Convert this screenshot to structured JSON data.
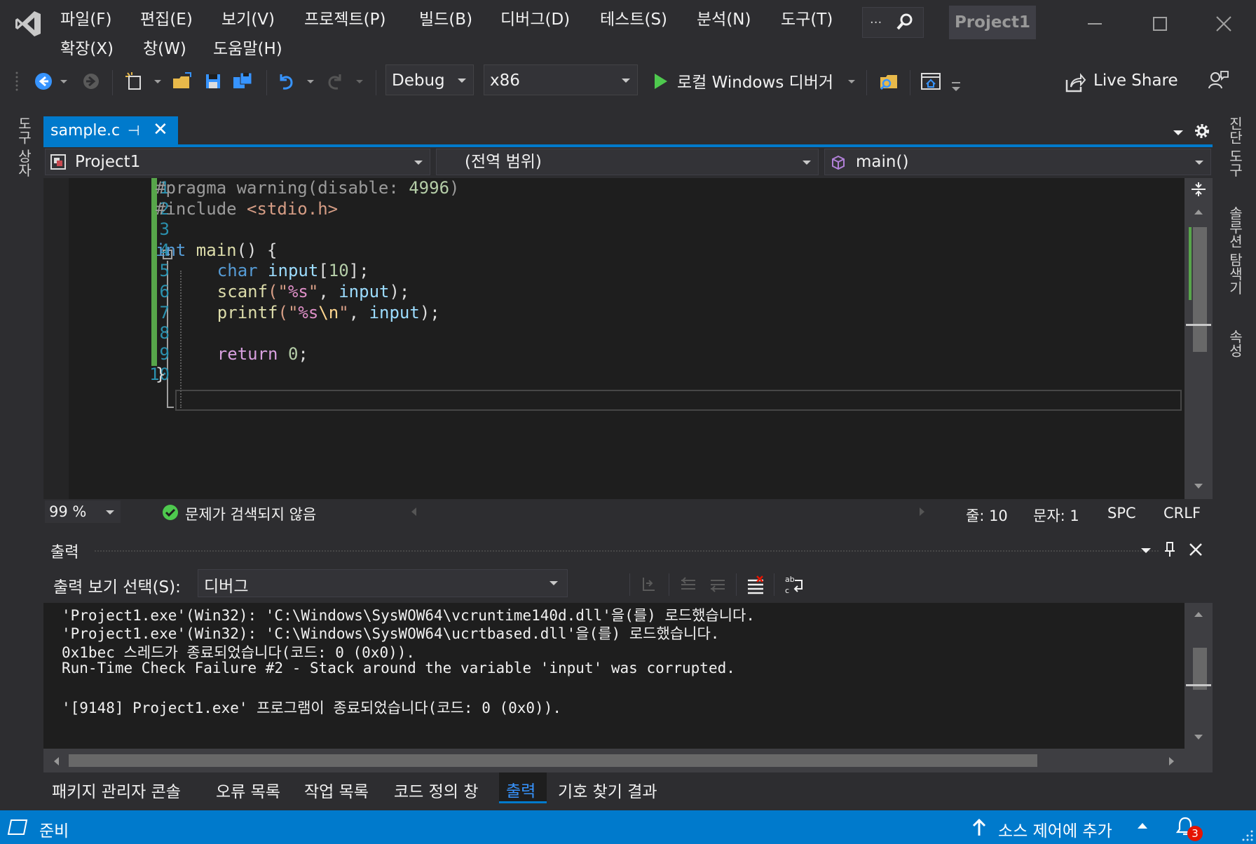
{
  "menu": {
    "items": [
      "파일(F)",
      "편집(E)",
      "보기(V)",
      "프로젝트(P)",
      "빌드(B)",
      "디버그(D)",
      "테스트(S)",
      "분석(N)",
      "도구(T)",
      "확장(X)",
      "창(W)",
      "도움말(H)"
    ],
    "search_dots": "...",
    "project_title": "Project1"
  },
  "toolbar": {
    "configuration": "Debug",
    "platform": "x86",
    "run_label": "로컬 Windows 디버거",
    "live_share": "Live Share"
  },
  "side": {
    "left": [
      "도구 상자"
    ],
    "right": [
      "진단 도구",
      "솔루션 탐색기",
      "속성"
    ]
  },
  "editor": {
    "tab_label": "sample.c",
    "nav_project": "Project1",
    "nav_scope": "(전역 범위)",
    "nav_member": "main()",
    "line_numbers": [
      "1",
      "2",
      "3",
      "4",
      "5",
      "6",
      "7",
      "8",
      "9",
      "10"
    ],
    "lines": [
      [
        {
          "t": "#pragma warning(disable: ",
          "c": "pp"
        },
        {
          "t": "4996",
          "c": "num"
        },
        {
          "t": ")",
          "c": "pp"
        }
      ],
      [
        {
          "t": "#include ",
          "c": "pp"
        },
        {
          "t": "<stdio.h>",
          "c": "str"
        }
      ],
      [],
      [
        {
          "t": "int",
          "c": "kw"
        },
        {
          "t": " main",
          "c": "fn"
        },
        {
          "t": "() {",
          "c": "plain"
        }
      ],
      [
        {
          "t": "    ",
          "c": "plain"
        },
        {
          "t": "char",
          "c": "kw"
        },
        {
          "t": " input",
          "c": "var"
        },
        {
          "t": "[",
          "c": "plain"
        },
        {
          "t": "10",
          "c": "num"
        },
        {
          "t": "];",
          "c": "plain"
        }
      ],
      [
        {
          "t": "    ",
          "c": "plain"
        },
        {
          "t": "scanf",
          "c": "fn"
        },
        {
          "t": "(\"",
          "c": "str"
        },
        {
          "t": "%s",
          "c": "fmt"
        },
        {
          "t": "\"",
          "c": "str"
        },
        {
          "t": ", ",
          "c": "plain"
        },
        {
          "t": "input",
          "c": "var"
        },
        {
          "t": ");",
          "c": "plain"
        }
      ],
      [
        {
          "t": "    ",
          "c": "plain"
        },
        {
          "t": "printf",
          "c": "fn"
        },
        {
          "t": "(\"",
          "c": "str"
        },
        {
          "t": "%s",
          "c": "fmt"
        },
        {
          "t": "\\n",
          "c": "esc"
        },
        {
          "t": "\"",
          "c": "str"
        },
        {
          "t": ", ",
          "c": "plain"
        },
        {
          "t": "input",
          "c": "var"
        },
        {
          "t": ");",
          "c": "plain"
        }
      ],
      [],
      [
        {
          "t": "    ",
          "c": "plain"
        },
        {
          "t": "return",
          "c": "ctl"
        },
        {
          "t": " ",
          "c": "plain"
        },
        {
          "t": "0",
          "c": "num"
        },
        {
          "t": ";",
          "c": "plain"
        }
      ],
      [
        {
          "t": "}",
          "c": "plain"
        }
      ]
    ],
    "zoom": "99 %",
    "issues": "문제가 검색되지 않음",
    "line_status": "줄: 10",
    "col_status": "문자: 1",
    "spc": "SPC",
    "eol": "CRLF"
  },
  "output": {
    "title": "출력",
    "source_label": "출력 보기 선택(S):",
    "source_value": "디버그",
    "lines": [
      "'Project1.exe'(Win32): 'C:\\Windows\\SysWOW64\\vcruntime140d.dll'을(를) 로드했습니다.",
      "'Project1.exe'(Win32): 'C:\\Windows\\SysWOW64\\ucrtbased.dll'을(를) 로드했습니다.",
      "0x1bec 스레드가 종료되었습니다(코드: 0 (0x0)).",
      "Run-Time Check Failure #2 - Stack around the variable 'input' was corrupted.",
      "",
      "'[9148] Project1.exe' 프로그램이 종료되었습니다(코드: 0 (0x0))."
    ]
  },
  "bottom_tabs": {
    "items": [
      "패키지 관리자 콘솔",
      "오류 목록",
      "작업 목록",
      "코드 정의 창",
      "출력",
      "기호 찾기 결과"
    ],
    "active": "출력"
  },
  "status": {
    "ready": "준비",
    "source_control": "소스 제어에 추가",
    "notifications": "3"
  },
  "colors": {
    "accent": "#007acc",
    "editor_bg": "#1e1e1e",
    "chrome_bg": "#2d2d30",
    "change_bar": "#57a64a",
    "notification_badge": "#e51400"
  }
}
